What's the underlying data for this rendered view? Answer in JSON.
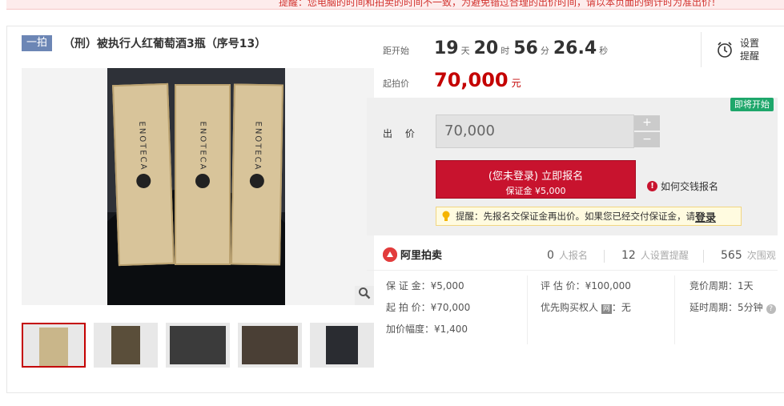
{
  "notice": {
    "text": "提醒：您电脑的时间和拍卖的时间不一致，为避免错过合理的出价时间，请以本页面的倒计时为准出价！"
  },
  "header": {
    "badge": "一拍",
    "title": "（刑）被执行人红葡萄酒3瓶（序号13）"
  },
  "countdown": {
    "label": "距开始",
    "days": "19",
    "days_unit": "天",
    "hours": "20",
    "hours_unit": "时",
    "minutes": "56",
    "minutes_unit": "分",
    "seconds": "26.4",
    "seconds_unit": "秒"
  },
  "start_price": {
    "label": "起拍价",
    "value": "70,000",
    "unit": "元"
  },
  "remind": {
    "label": "设置提醒",
    "icon": "alarm-clock-icon"
  },
  "status_badge": "即将开始",
  "bid": {
    "label": "出 价",
    "value": "70,000",
    "plus": "+",
    "minus": "−",
    "signup_main": "(您未登录) 立即报名",
    "signup_sub": "保证金 ¥5,000",
    "howto": "如何交钱报名",
    "tip_text": "提醒：先报名交保证金再出价。如果您已经交付保证金，请",
    "tip_login": "登录"
  },
  "stats": {
    "brand": "阿里拍卖",
    "signups_num": "0",
    "signups_label": "人报名",
    "reminders_num": "12",
    "reminders_label": "人设置提醒",
    "views_num": "565",
    "views_label": "次围观"
  },
  "details": {
    "deposit": "保 证 金：¥5,000",
    "start": "起 拍 价：¥70,000",
    "increment": "加价幅度：¥1,400",
    "appraisal": "评 估 价：¥100,000",
    "priority_label": "优先购买权人",
    "priority_tag": "网",
    "priority_value": "：无",
    "period": "竞价周期：1天",
    "extension": "延时周期：5分钟"
  },
  "image": {
    "box_text_1": "ENOTECA",
    "box_text_2": "ENOTECA",
    "box_text_3": "ENOTECA"
  },
  "colors": {
    "accent_red": "#c8132e",
    "price_red": "#c40000",
    "badge_blue": "#6c86b5",
    "soon_green": "#1ea76b"
  }
}
